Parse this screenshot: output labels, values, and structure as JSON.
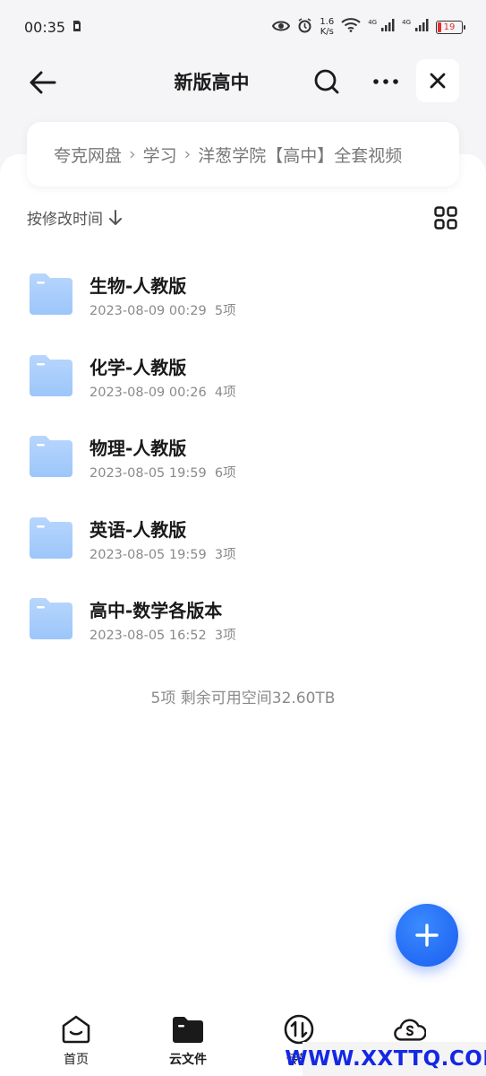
{
  "status_bar": {
    "time": "00:35",
    "net_speed_value": "1.6",
    "net_speed_unit": "K/s",
    "signal_tag_1": "4G",
    "signal_tag_2": "4G",
    "battery_level": "19"
  },
  "nav": {
    "title": "新版高中"
  },
  "breadcrumb": {
    "items": [
      "夸克网盘",
      "学习",
      "洋葱学院【高中】全套视频"
    ]
  },
  "sort": {
    "label": "按修改时间"
  },
  "files": [
    {
      "name": "生物-人教版",
      "date": "2023-08-09 00:29",
      "count": "5项"
    },
    {
      "name": "化学-人教版",
      "date": "2023-08-09 00:26",
      "count": "4项"
    },
    {
      "name": "物理-人教版",
      "date": "2023-08-05 19:59",
      "count": "6项"
    },
    {
      "name": "英语-人教版",
      "date": "2023-08-05 19:59",
      "count": "3项"
    },
    {
      "name": "高中-数学各版本",
      "date": "2023-08-05 16:52",
      "count": "3项"
    }
  ],
  "summary": "5项 剩余可用空间32.60TB",
  "tabs": [
    {
      "label": "首页"
    },
    {
      "label": "云文件"
    },
    {
      "label": "传输"
    },
    {
      "label": "会员"
    }
  ],
  "watermark": "WWW.XXTTQ.COM",
  "colors": {
    "accent": "#1a5cf0",
    "folder": "#a9cdfb",
    "watermark": "#1427e6"
  }
}
